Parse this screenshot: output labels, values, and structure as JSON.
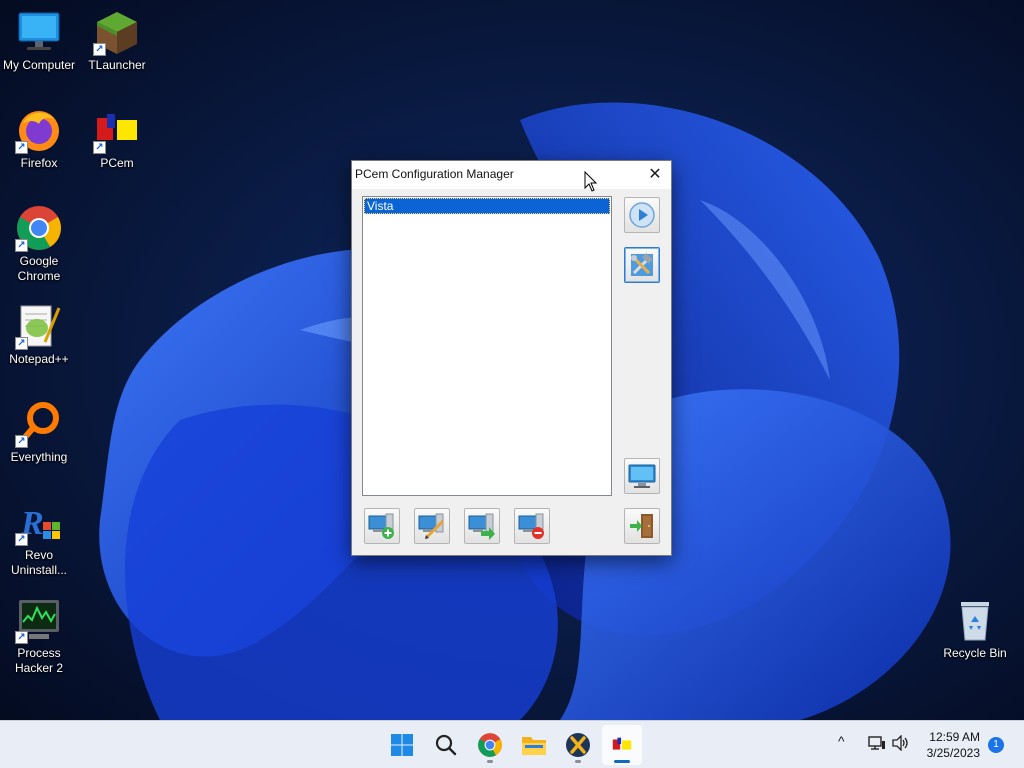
{
  "desktop": {
    "icons": [
      {
        "label": "My Computer"
      },
      {
        "label": "TLauncher"
      },
      {
        "label": "Firefox"
      },
      {
        "label": "PCem"
      },
      {
        "label": "Google Chrome"
      },
      {
        "label": "Notepad++"
      },
      {
        "label": "Everything"
      },
      {
        "label": "Revo Uninstall..."
      },
      {
        "label": "Process Hacker 2"
      },
      {
        "label": "Recycle Bin"
      }
    ]
  },
  "window": {
    "title": "PCem Configuration Manager",
    "close_glyph": "✕",
    "configs": [
      "Vista"
    ],
    "buttons": {
      "run": "play-icon",
      "configure": "tools-icon",
      "screen": "monitor-icon",
      "exit": "exit-door-icon",
      "new": "add-machine-icon",
      "edit": "edit-machine-icon",
      "copy": "copy-machine-icon",
      "delete": "delete-machine-icon"
    }
  },
  "taskbar": {
    "apps": [
      "start-icon",
      "search-icon",
      "chrome-icon",
      "file-explorer-icon",
      "xampp-icon",
      "pcem-icon"
    ],
    "tray_chevron": "^",
    "clock": {
      "time": "12:59 AM",
      "date": "3/25/2023"
    },
    "notification_count": "1"
  },
  "colors": {
    "accent": "#0a64d6",
    "wallpaper_dark": "#06112e",
    "wallpaper_bloom": "#1d4de8"
  }
}
